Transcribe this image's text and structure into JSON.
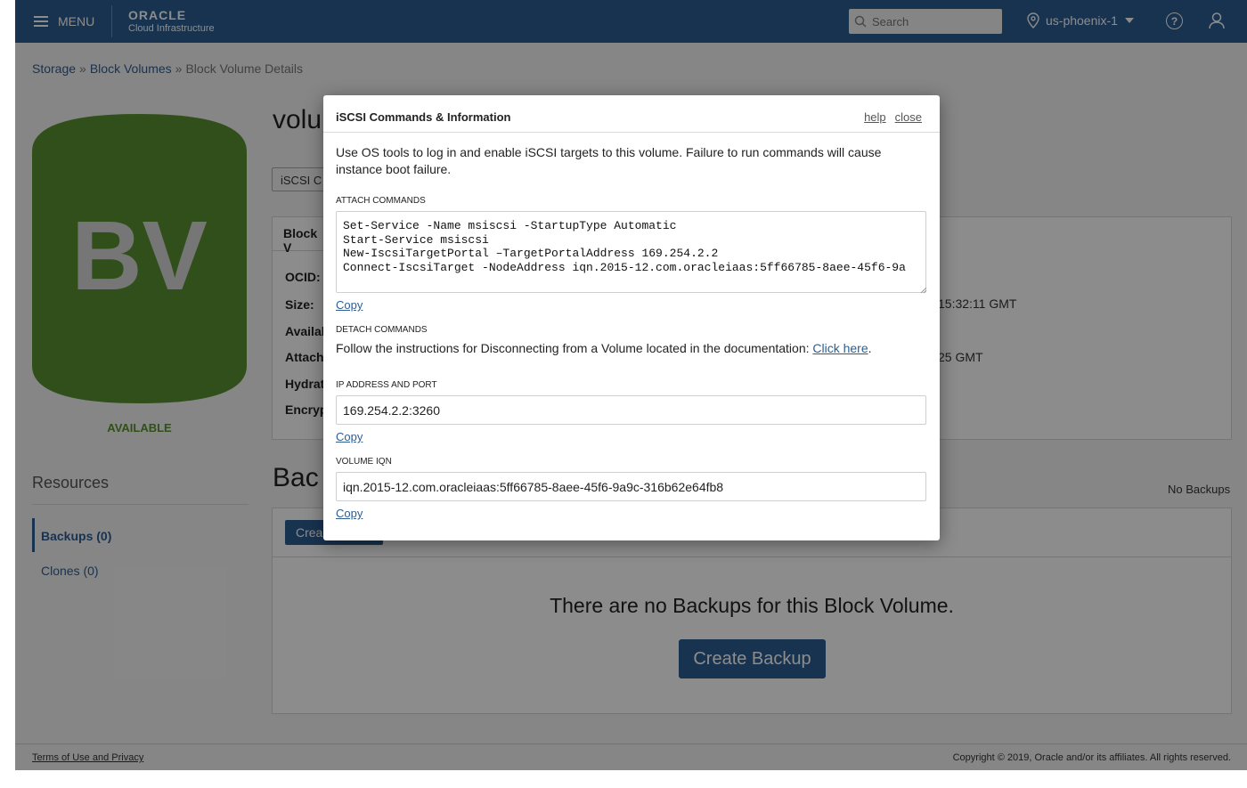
{
  "topbar": {
    "menu_label": "MENU",
    "logo_line1": "ORACLE",
    "logo_line2": "Cloud Infrastructure",
    "search_placeholder": "Search",
    "region": "us-phoenix-1"
  },
  "breadcrumb": {
    "items": [
      "Storage",
      "Block Volumes",
      "Block Volume Details"
    ],
    "separator": "»"
  },
  "volume": {
    "icon_text": "BV",
    "icon_color": "#5a9131",
    "status": "AVAILABLE",
    "title_partial": "volu",
    "iscsi_button_partial": "iSCSI C",
    "info_tab_partial": "Block V",
    "labels_partial": [
      "OCID:",
      "Size:",
      "Availab",
      "Attach",
      "Hydrat",
      "Encryp"
    ],
    "right_values_partial": [
      "15:32:11 GMT",
      "25 GMT"
    ]
  },
  "resources": {
    "title": "Resources",
    "items": [
      "Backups (0)",
      "Clones (0)"
    ]
  },
  "backups": {
    "title_partial": "Bac",
    "no_backups": "No Backups",
    "create_small_partial": "Crea",
    "empty_text": "There are no Backups for this Block Volume.",
    "create_button": "Create Backup"
  },
  "footer": {
    "left": "Terms of Use and Privacy",
    "right": "Copyright © 2019, Oracle and/or its affiliates. All rights reserved."
  },
  "modal": {
    "title": "iSCSI Commands & Information",
    "help_link": "help",
    "close_link": "close",
    "description": "Use OS tools to log in and enable iSCSI targets to this volume. Failure to run commands will cause instance boot failure.",
    "attach_label": "ATTACH COMMANDS",
    "attach_commands": "Set-Service -Name msiscsi -StartupType Automatic\nStart-Service msiscsi\nNew-IscsiTargetPortal –TargetPortalAddress 169.254.2.2\nConnect-IscsiTarget -NodeAddress iqn.2015-12.com.oracleiaas:5ff66785-8aee-45f6-9a",
    "copy_label": "Copy",
    "detach_label": "DETACH COMMANDS",
    "detach_text": "Follow the instructions for Disconnecting from a Volume located in the documentation: ",
    "detach_link": "Click here",
    "detach_suffix": ".",
    "ip_label": "IP ADDRESS AND PORT",
    "ip_value": "169.254.2.2:3260",
    "iqn_label": "VOLUME IQN",
    "iqn_value": "iqn.2015-12.com.oracleiaas:5ff66785-8aee-45f6-9a9c-316b62e64fb8"
  },
  "colors": {
    "brand": "#2c5e93",
    "status_green": "#5a9131"
  }
}
